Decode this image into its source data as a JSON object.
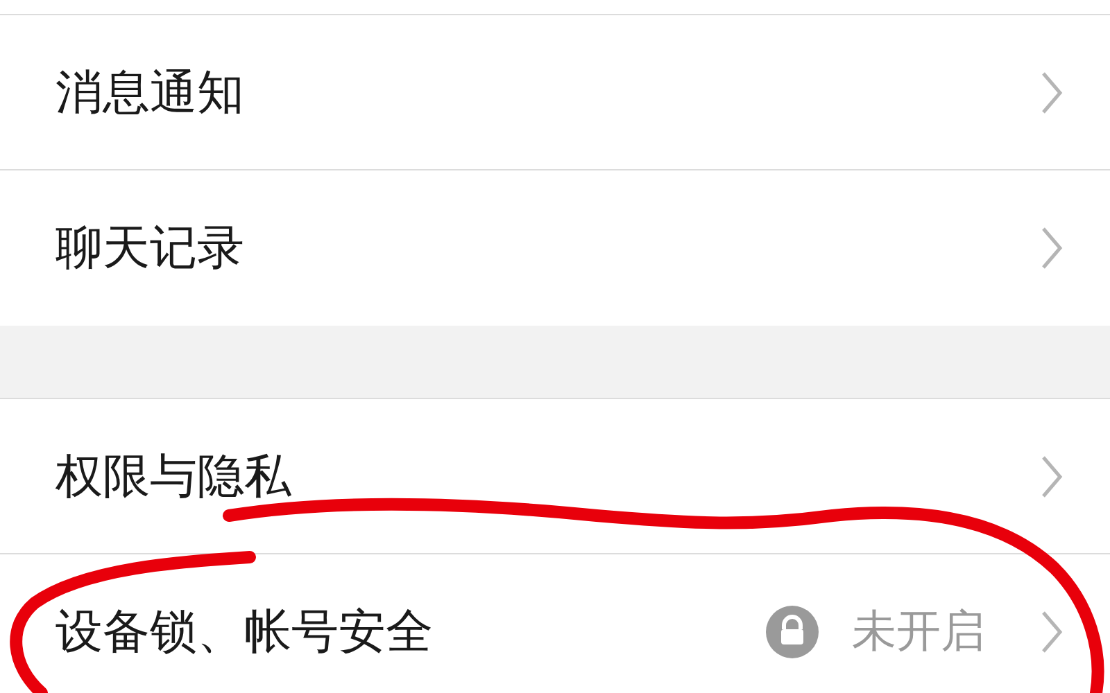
{
  "groups": [
    {
      "items": [
        {
          "label": "消息通知"
        },
        {
          "label": "聊天记录"
        }
      ]
    },
    {
      "items": [
        {
          "label": "权限与隐私",
          "locked": false
        },
        {
          "label": "设备锁、帐号安全",
          "locked": true,
          "status": "未开启"
        }
      ]
    }
  ]
}
